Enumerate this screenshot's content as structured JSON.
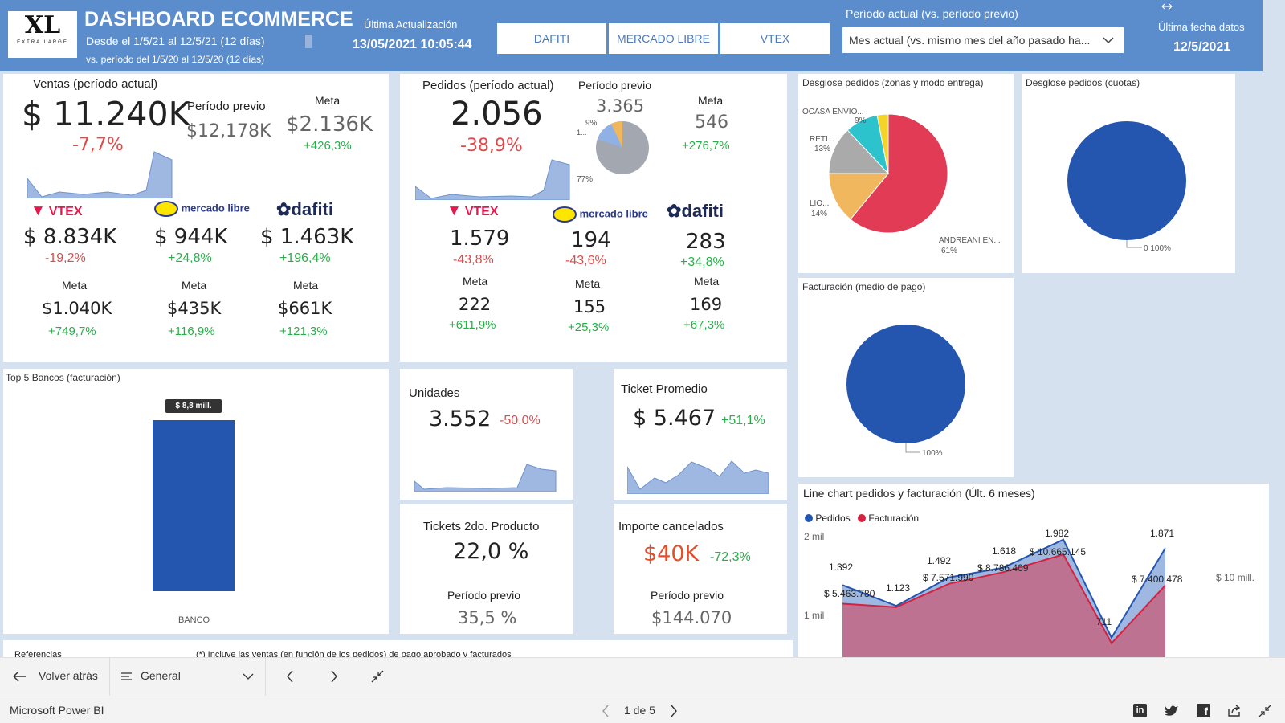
{
  "header": {
    "logo_text": "XL",
    "logo_sub": "EXTRA LARGE",
    "title": "DASHBOARD ECOMMERCE",
    "range": "Desde el 1/5/21 al 12/5/21 (12 días)",
    "range_prev": "vs. período del 1/5/20 al 12/5/20 (12 días)",
    "update_label": "Última Actualización",
    "update_value": "13/05/2021 10:05:44",
    "tabs": [
      "DAFITI",
      "MERCADO LIBRE",
      "VTEX"
    ],
    "period_label": "Período actual (vs. período previo)",
    "period_value": "Mes actual (vs. mismo mes del año pasado ha...",
    "last_date_label": "Última fecha datos",
    "last_date_value": "12/5/2021"
  },
  "sales": {
    "title": "Ventas (período actual)",
    "value": "$ 11.240K",
    "change": "-7,7%",
    "prev_label": "Período previo",
    "prev_value": "$12,178K",
    "meta_label": "Meta",
    "meta_value": "$2.136K",
    "meta_change": "+426,3%",
    "brands": [
      {
        "name": "VTEX",
        "value": "$ 8.834K",
        "change": "-19,2%",
        "meta_label": "Meta",
        "meta_value": "$1.040K",
        "meta_change": "+749,7%"
      },
      {
        "name": "mercado libre",
        "value": "$ 944K",
        "change": "+24,8%",
        "meta_label": "Meta",
        "meta_value": "$435K",
        "meta_change": "+116,9%"
      },
      {
        "name": "dafiti",
        "value": "$ 1.463K",
        "change": "+196,4%",
        "meta_label": "Meta",
        "meta_value": "$661K",
        "meta_change": "+121,3%"
      }
    ]
  },
  "orders": {
    "title": "Pedidos (período actual)",
    "value": "2.056",
    "change": "-38,9%",
    "prev_label": "Período previo",
    "prev_value": "3.365",
    "pie_labels": [
      "9%",
      "1...",
      "77%"
    ],
    "meta_label": "Meta",
    "meta_value": "546",
    "meta_change": "+276,7%",
    "brands": [
      {
        "name": "VTEX",
        "value": "1.579",
        "change": "-43,8%",
        "meta_label": "Meta",
        "meta_value": "222",
        "meta_change": "+611,9%"
      },
      {
        "name": "mercado libre",
        "value": "194",
        "change": "-43,6%",
        "meta_label": "Meta",
        "meta_value": "155",
        "meta_change": "+25,3%"
      },
      {
        "name": "dafiti",
        "value": "283",
        "change": "+34,8%",
        "meta_label": "Meta",
        "meta_value": "169",
        "meta_change": "+67,3%"
      }
    ]
  },
  "breakdown_zones": {
    "title": "Desglose pedidos (zonas y modo entrega)",
    "labels": [
      {
        "name": "OCASA ENVIO...",
        "pct": "9%"
      },
      {
        "name": "RETI...",
        "pct": "13%"
      },
      {
        "name": "LIO...",
        "pct": "14%"
      },
      {
        "name": "ANDREANI EN...",
        "pct": "61%"
      }
    ]
  },
  "breakdown_cuotas": {
    "title": "Desglose pedidos (cuotas)",
    "label": "0 100%"
  },
  "billing_method": {
    "title": "Facturación (medio de pago)",
    "label": "100%"
  },
  "banks": {
    "title": "Top 5 Bancos (facturación)",
    "bar_label": "$ 8,8 mill.",
    "category": "BANCO"
  },
  "units": {
    "title": "Unidades",
    "value": "3.552",
    "change": "-50,0%"
  },
  "ticket": {
    "title": "Ticket Promedio",
    "value": "$ 5.467",
    "change": "+51,1%"
  },
  "second_product": {
    "title": "Tickets 2do. Producto",
    "value": "22,0 %",
    "prev_label": "Período previo",
    "prev_value": "35,5 %"
  },
  "cancelled": {
    "title": "Importe cancelados",
    "value": "$40K",
    "change": "-72,3%",
    "prev_label": "Período previo",
    "prev_value": "$144.070"
  },
  "line_chart": {
    "title": "Line chart pedidos y facturación (Últ. 6 meses)",
    "legend": [
      "Pedidos",
      "Facturación"
    ],
    "y_ticks": [
      "2 mil",
      "1 mil"
    ],
    "y2_tick": "$ 10 mill.",
    "order_labels": [
      "1.392",
      "1.123",
      "1.492",
      "1.618",
      "1.982",
      "711",
      "1.871"
    ],
    "billing_labels": [
      "$ 5.463.780",
      "$ 7.571.990",
      "$ 8.786.409",
      "$ 10.665.145",
      "$ 7.400.478"
    ]
  },
  "footer": {
    "back_label": "Volver atrás",
    "page_select": "General",
    "page_indicator": "1 de 5",
    "app_name": "Microsoft Power BI",
    "note_left": "Referencias",
    "note_right": "(*) Incluye las ventas (en función de los pedidos) de pago aprobado y facturados"
  },
  "chart_data": [
    {
      "type": "line",
      "title": "Line chart pedidos y facturación (Últ. 6 meses)",
      "series": [
        {
          "name": "Pedidos",
          "values": [
            1392,
            1123,
            1492,
            1618,
            1982,
            711,
            1871
          ]
        },
        {
          "name": "Facturación",
          "values": [
            5463780,
            null,
            7571990,
            8786409,
            10665145,
            null,
            7400478
          ]
        }
      ],
      "y_ticks": [
        "1 mil",
        "2 mil"
      ]
    },
    {
      "type": "pie",
      "title": "Desglose pedidos (zonas y modo entrega)",
      "categories": [
        "ANDREANI EN...",
        "LIO...",
        "RETI...",
        "OCASA ENVIO..."
      ],
      "values": [
        61,
        14,
        13,
        9
      ]
    },
    {
      "type": "bar",
      "title": "Top 5 Bancos (facturación)",
      "categories": [
        "BANCO"
      ],
      "values": [
        8.8
      ]
    }
  ],
  "colors": {
    "header": "#5b8ccc",
    "pie_red": "#e23b55",
    "pie_orange": "#f0b75e",
    "pie_grey": "#aaaaaa",
    "pie_cyan": "#2cc3cc",
    "pie_yellow": "#f2d42a",
    "blue": "#2456b0",
    "spark": "#9fb8e2"
  }
}
